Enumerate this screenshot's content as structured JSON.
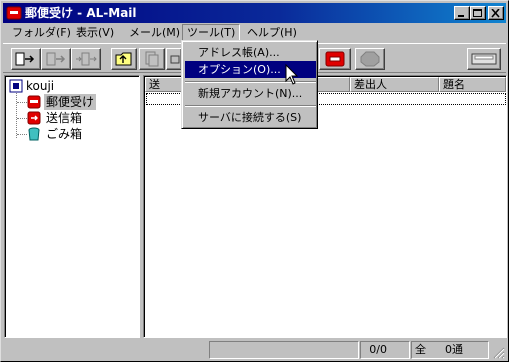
{
  "window": {
    "title": "郵便受け - AL-Mail"
  },
  "menubar": {
    "items": [
      {
        "label": "フォルダ(F)"
      },
      {
        "label": "表示(V)"
      },
      {
        "label": "メール(M)"
      },
      {
        "label": "ツール(T)"
      },
      {
        "label": "ヘルプ(H)"
      }
    ]
  },
  "tools_menu": {
    "items": [
      {
        "label": "アドレス帳(A)..."
      },
      {
        "label": "オプション(O)..."
      },
      {
        "label": "新規アカウント(N)..."
      },
      {
        "label": "サーバに接続する(S)"
      }
    ],
    "highlighted": "オプション(O)..."
  },
  "folder_tree": {
    "account": "kouji",
    "folders": [
      {
        "label": "郵便受け",
        "icon": "mailbox-icon",
        "selected": true
      },
      {
        "label": "送信箱",
        "icon": "outbox-icon",
        "selected": false
      },
      {
        "label": "ごみ箱",
        "icon": "trash-icon",
        "selected": false
      }
    ]
  },
  "message_list": {
    "columns": [
      {
        "label": "送"
      },
      {
        "label": "差出人"
      },
      {
        "label": "題名"
      }
    ]
  },
  "statusbar": {
    "count": "0/0",
    "total_label": "全",
    "total_value": "0通"
  },
  "colors": {
    "title_active": "#000080",
    "menu_highlight": "#000080",
    "face": "#c0c0c0",
    "mailbox_red": "#e00000"
  }
}
